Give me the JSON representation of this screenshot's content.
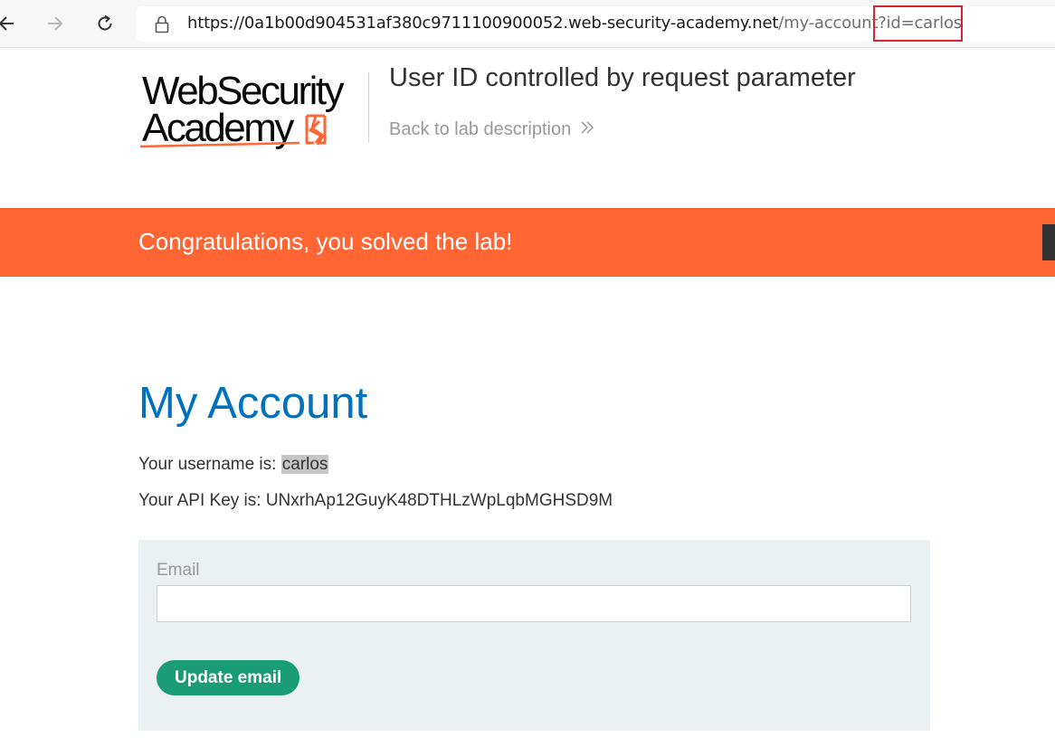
{
  "browser": {
    "url_host": "https://0a1b00d904531af380c9711100900052.web-security-academy.net",
    "url_path": "/my-account?id=carlos",
    "highlight_color": "#d9232e",
    "icons": [
      "back-arrow-icon",
      "forward-arrow-icon",
      "reload-icon",
      "lock-icon"
    ]
  },
  "header": {
    "logo_line1": "WebSecurity",
    "logo_line2": "Academy",
    "lab_title": "User ID controlled by request parameter",
    "back_link": "Back to lab description",
    "back_link_icon": "double-chevron-right-icon"
  },
  "banner": {
    "message": "Congratulations, you solved the lab!",
    "color": "#ff6633"
  },
  "account": {
    "heading": "My Account",
    "username_prefix": "Your username is: ",
    "username": "carlos",
    "api_key_line": "Your API Key is: UNxrhAp12GuyK48DTHLzWpLqbMGHSD9M"
  },
  "form": {
    "email_label": "Email",
    "email_value": "",
    "button_label": "Update email",
    "button_color": "#1a9c77"
  }
}
